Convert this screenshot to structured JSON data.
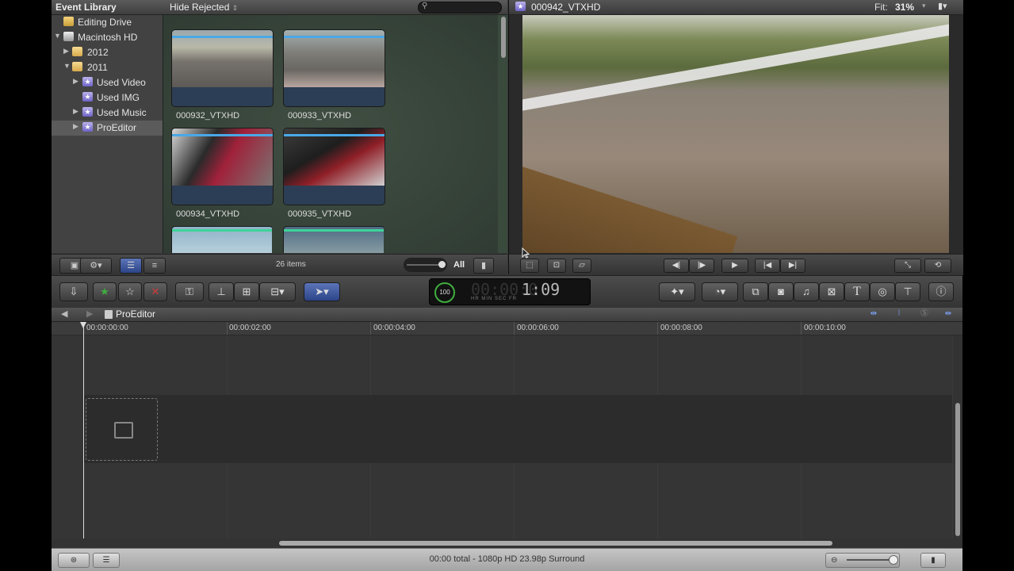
{
  "library": {
    "title": "Event Library",
    "filter": "Hide Rejected",
    "filter_arrow": "⇕",
    "search_icon": "⚲",
    "tree": [
      {
        "label": "Editing Drive",
        "icon": "drive-icon",
        "level": 0,
        "disclosure": ""
      },
      {
        "label": "Macintosh HD",
        "icon": "hard-disk-icon",
        "level": 0,
        "disclosure": "▼"
      },
      {
        "label": "2012",
        "icon": "folder-icon",
        "level": 1,
        "disclosure": "▶"
      },
      {
        "label": "2011",
        "icon": "folder-icon",
        "level": 1,
        "disclosure": "▼"
      },
      {
        "label": "Used Video",
        "icon": "event-star-icon",
        "level": 2,
        "disclosure": "▶"
      },
      {
        "label": "Used IMG",
        "icon": "event-star-icon",
        "level": 2,
        "disclosure": ""
      },
      {
        "label": "Used Music",
        "icon": "event-star-icon",
        "level": 2,
        "disclosure": "▶"
      },
      {
        "label": "ProEditor",
        "icon": "event-star-icon",
        "level": 2,
        "disclosure": "▶",
        "selected": true
      }
    ],
    "clips": [
      {
        "name": "000932_VTXHD"
      },
      {
        "name": "000933_VTXHD"
      },
      {
        "name": "000934_VTXHD"
      },
      {
        "name": "000935_VTXHD"
      },
      {
        "name": ""
      },
      {
        "name": ""
      }
    ],
    "item_count": "26 items",
    "zoom_all": "All"
  },
  "viewer": {
    "title": "000942_VTXHD",
    "fit_label": "Fit:",
    "zoom": "31%"
  },
  "toolbar": {
    "timecode_ring": "100",
    "timecode_faded": "00:00:0",
    "timecode_value": "1:09",
    "timecode_units": "HR   MIN   SEC   FR"
  },
  "timeline": {
    "project": "ProEditor",
    "ruler": [
      "00:00:00:00",
      "00:00:02:00",
      "00:00:04:00",
      "00:00:06:00",
      "00:00:08:00",
      "00:00:10:00"
    ]
  },
  "status": {
    "text": "00:00 total - 1080p HD 23.98p Surround"
  },
  "colors": {
    "accent_blue": "#4aa8e6",
    "favorite_green": "#3fae3f",
    "reject_red": "#d23a3a"
  }
}
